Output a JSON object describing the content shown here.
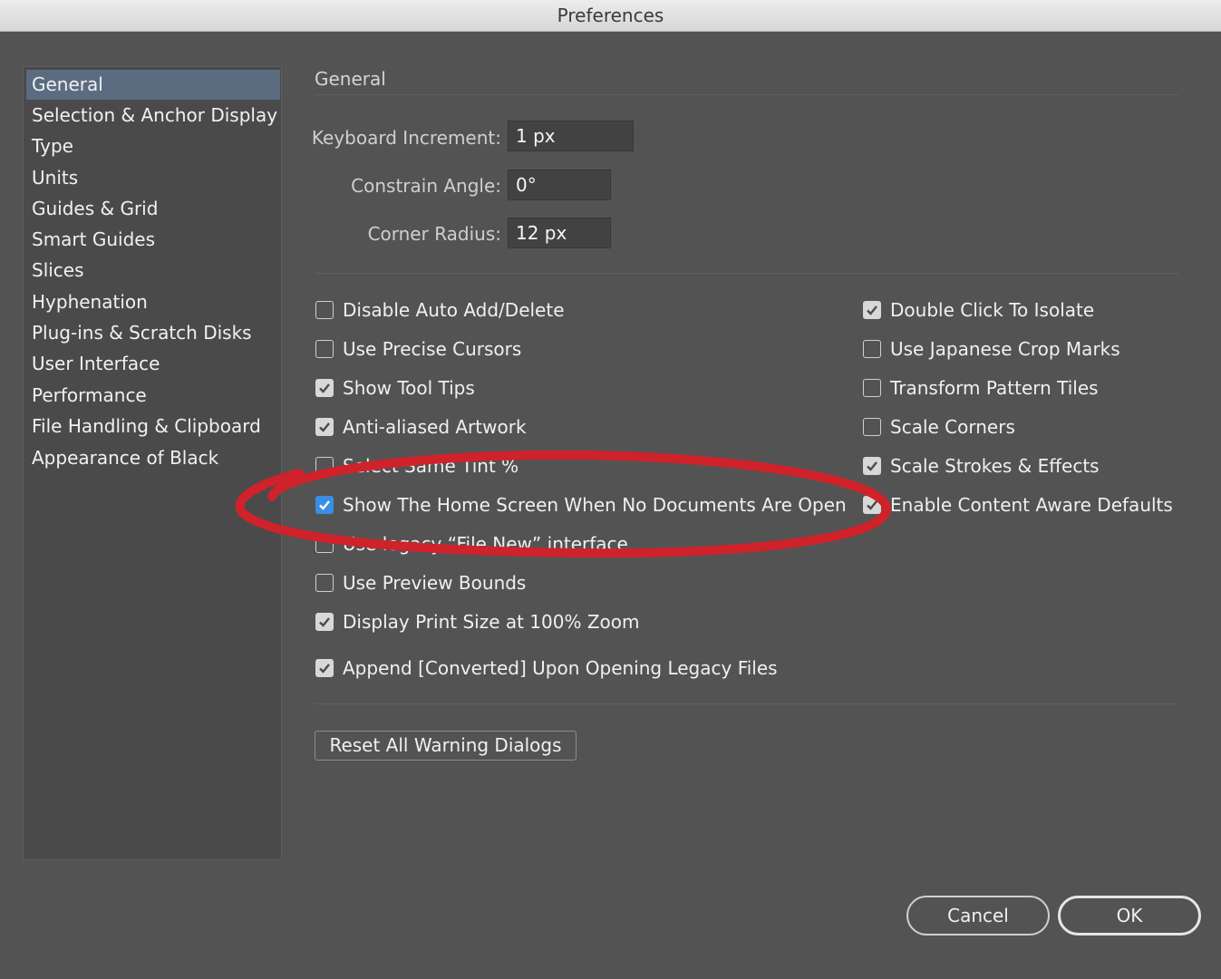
{
  "window": {
    "title": "Preferences"
  },
  "sidebar": {
    "items": [
      {
        "label": "General",
        "selected": true
      },
      {
        "label": "Selection & Anchor Display"
      },
      {
        "label": "Type"
      },
      {
        "label": "Units"
      },
      {
        "label": "Guides & Grid"
      },
      {
        "label": "Smart Guides"
      },
      {
        "label": "Slices"
      },
      {
        "label": "Hyphenation"
      },
      {
        "label": "Plug-ins & Scratch Disks"
      },
      {
        "label": "User Interface"
      },
      {
        "label": "Performance"
      },
      {
        "label": "File Handling & Clipboard"
      },
      {
        "label": "Appearance of Black"
      }
    ]
  },
  "main": {
    "section_title": "General",
    "fields": {
      "keyboard_increment": {
        "label": "Keyboard Increment:",
        "value": "1 px"
      },
      "constrain_angle": {
        "label": "Constrain Angle:",
        "value": "0°"
      },
      "corner_radius": {
        "label": "Corner Radius:",
        "value": "12 px"
      }
    },
    "left_options": [
      {
        "label": "Disable Auto Add/Delete",
        "checked": false
      },
      {
        "label": "Use Precise Cursors",
        "checked": false
      },
      {
        "label": "Show Tool Tips",
        "checked": true
      },
      {
        "label": "Anti-aliased Artwork",
        "checked": true
      },
      {
        "label": "Select Same Tint %",
        "checked": false
      },
      {
        "label": "Show The Home Screen When No Documents Are Open",
        "checked": true
      },
      {
        "label": "Use legacy “File New” interface",
        "checked": false
      },
      {
        "label": "Use Preview Bounds",
        "checked": false
      },
      {
        "label": "Display Print Size at 100% Zoom",
        "checked": true
      },
      {
        "label": "Append [Converted] Upon Opening Legacy Files",
        "checked": true
      }
    ],
    "right_options": [
      {
        "label": "Double Click To Isolate",
        "checked": true
      },
      {
        "label": "Use Japanese Crop Marks",
        "checked": false
      },
      {
        "label": "Transform Pattern Tiles",
        "checked": false
      },
      {
        "label": "Scale Corners",
        "checked": false
      },
      {
        "label": "Scale Strokes & Effects",
        "checked": true
      },
      {
        "label": "Enable Content Aware Defaults",
        "checked": true
      }
    ],
    "reset_button": "Reset All Warning Dialogs"
  },
  "footer": {
    "cancel": "Cancel",
    "ok": "OK"
  },
  "colors": {
    "highlight_ring": "#d0222a",
    "selection": "#5b6c80",
    "accent_check": "#3a8ee6"
  }
}
